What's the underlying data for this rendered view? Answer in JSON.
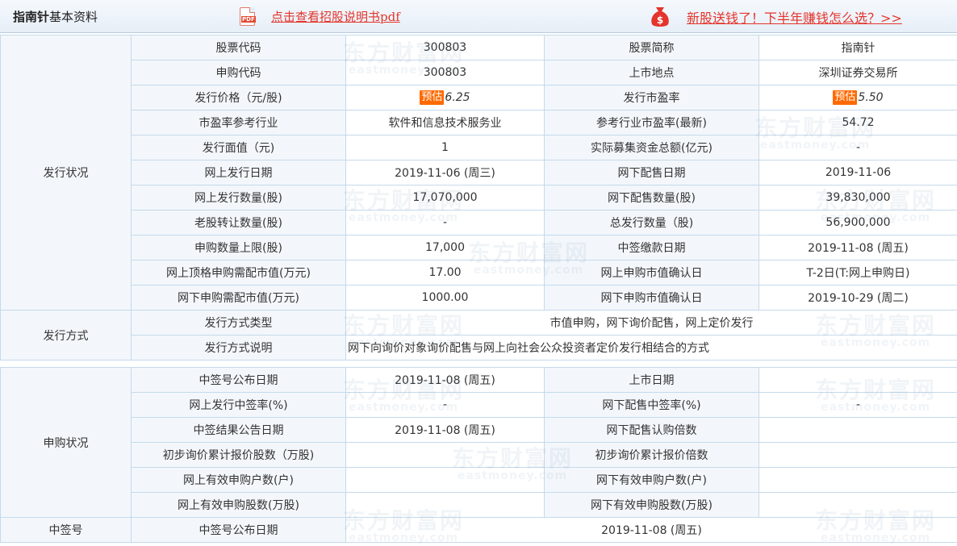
{
  "header": {
    "title_bold": "指南针",
    "title_rest": "基本资料",
    "pdf_icon_text": "PDF",
    "pdf_link": "点击查看招股说明书pdf",
    "money_icon_text": "$",
    "promo_link": "新股送钱了！下半年赚钱怎么选？>>"
  },
  "estimate_badge": "预估",
  "issuance": {
    "section": "发行状况",
    "rows": [
      {
        "l1": "股票代码",
        "v1": "300803",
        "l2": "股票简称",
        "v2": "指南针"
      },
      {
        "l1": "申购代码",
        "v1": "300803",
        "l2": "上市地点",
        "v2": "深圳证券交易所"
      },
      {
        "l1": "发行价格（元/股)",
        "v1": "6.25",
        "l2": "发行市盈率",
        "v2": "5.50"
      },
      {
        "l1": "市盈率参考行业",
        "v1": "软件和信息技术服务业",
        "l2": "参考行业市盈率(最新)",
        "v2": "54.72"
      },
      {
        "l1": "发行面值（元)",
        "v1": "1",
        "l2": "实际募集资金总额(亿元)",
        "v2": "-"
      },
      {
        "l1": "网上发行日期",
        "v1": "2019-11-06 (周三)",
        "l2": "网下配售日期",
        "v2": "2019-11-06"
      },
      {
        "l1": "网上发行数量(股)",
        "v1": "17,070,000",
        "l2": "网下配售数量(股)",
        "v2": "39,830,000"
      },
      {
        "l1": "老股转让数量(股)",
        "v1": "-",
        "l2": "总发行数量（股)",
        "v2": "56,900,000"
      },
      {
        "l1": "申购数量上限(股)",
        "v1": "17,000",
        "l2": "中签缴款日期",
        "v2": "2019-11-08 (周五)"
      },
      {
        "l1": "网上顶格申购需配市值(万元)",
        "v1": "17.00",
        "l2": "网上申购市值确认日",
        "v2": "T-2日(T:网上申购日)"
      },
      {
        "l1": "网下申购需配市值(万元)",
        "v1": "1000.00",
        "l2": "网下申购市值确认日",
        "v2": "2019-10-29 (周二)"
      }
    ]
  },
  "method": {
    "section": "发行方式",
    "rows": [
      {
        "label": "发行方式类型",
        "value": "市值申购，网下询价配售，网上定价发行"
      },
      {
        "label": "发行方式说明",
        "value": "网下向询价对象询价配售与网上向社会公众投资者定价发行相结合的方式"
      }
    ]
  },
  "subscription": {
    "section": "申购状况",
    "rows": [
      {
        "l1": "中签号公布日期",
        "v1": "2019-11-08 (周五)",
        "l2": "上市日期",
        "v2": ""
      },
      {
        "l1": "网上发行中签率(%)",
        "v1": "-",
        "l2": "网下配售中签率(%)",
        "v2": "-"
      },
      {
        "l1": "中签结果公告日期",
        "v1": "2019-11-08 (周五)",
        "l2": "网下配售认购倍数",
        "v2": ""
      },
      {
        "l1": "初步询价累计报价股数（万股)",
        "v1": "",
        "l2": "初步询价累计报价倍数",
        "v2": ""
      },
      {
        "l1": "网上有效申购户数(户)",
        "v1": "",
        "l2": "网下有效申购户数(户)",
        "v2": ""
      },
      {
        "l1": "网上有效申购股数(万股)",
        "v1": "",
        "l2": "网下有效申购股数(万股)",
        "v2": ""
      }
    ]
  },
  "lottery": {
    "section": "中签号",
    "label": "中签号公布日期",
    "value": "2019-11-08 (周五)"
  },
  "watermark": {
    "cn": "东方财富网",
    "en": "eastmoney.com"
  },
  "colors": {
    "link_red": "#e4342b",
    "badge_orange": "#ff6a00",
    "border": "#c5d9eb",
    "label_bg": "#f3f7fb"
  }
}
